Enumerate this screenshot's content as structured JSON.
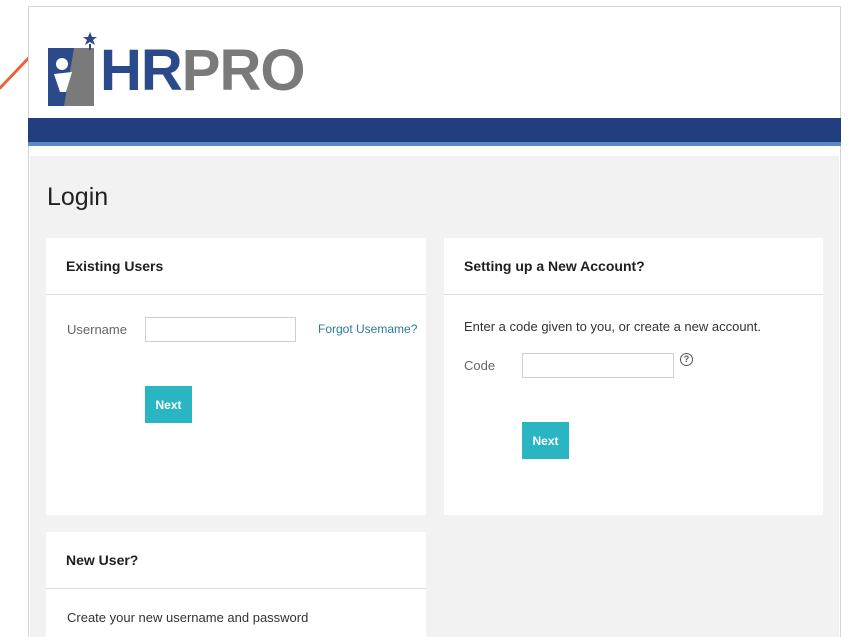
{
  "brand": {
    "hr": "HR",
    "pro": "PRO",
    "colors": {
      "primary": "#213f7f",
      "accent_bar": "#5d8ac0",
      "button": "#2ab5c2",
      "pointer": "#e5663a"
    }
  },
  "page": {
    "title": "Login"
  },
  "existing_users": {
    "heading": "Existing Users",
    "username_label": "Username",
    "username_value": "",
    "forgot_link": "Forgot Usemame?",
    "next_label": "Next"
  },
  "new_account": {
    "heading": "Setting up a New Account?",
    "description": "Enter a code given to you, or create a new account.",
    "code_label": "Code",
    "code_value": "",
    "help_icon": "question-circle-icon",
    "help_glyph": "?",
    "next_label": "Next"
  },
  "new_user": {
    "heading": "New User?",
    "description": "Create your new username and password"
  }
}
